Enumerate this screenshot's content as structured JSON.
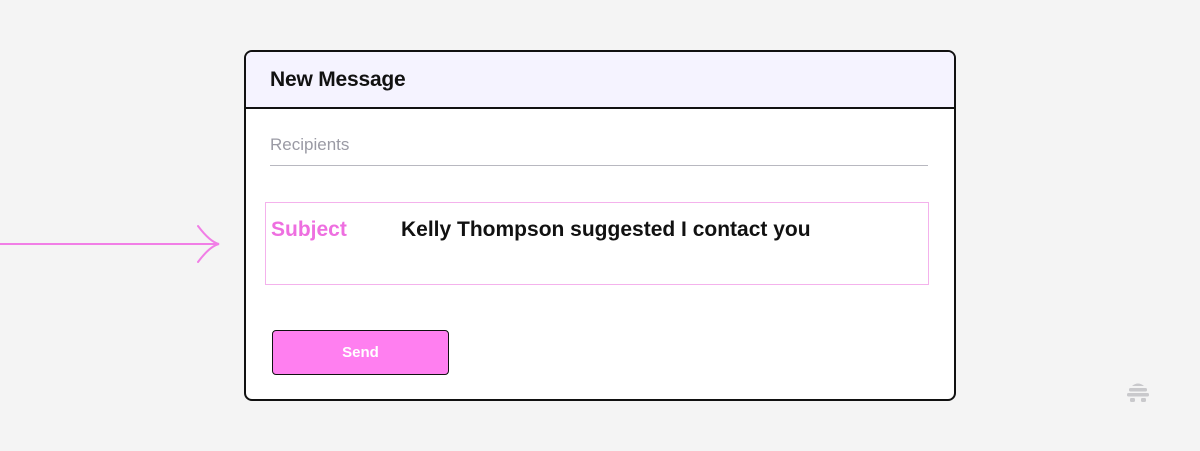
{
  "window": {
    "title": "New Message"
  },
  "recipients": {
    "placeholder": "Recipients",
    "value": ""
  },
  "subject": {
    "label": "Subject",
    "value": "Kelly Thompson suggested I contact you"
  },
  "send_button": {
    "label": "Send"
  },
  "icons": {
    "arrow": "arrow-right-icon",
    "logo": "brand-logo-icon"
  },
  "colors": {
    "accent": "#ff7ff0",
    "subject_label": "#ee6fe0",
    "header_bg": "#f5f3ff",
    "page_bg": "#f4f4f4"
  }
}
